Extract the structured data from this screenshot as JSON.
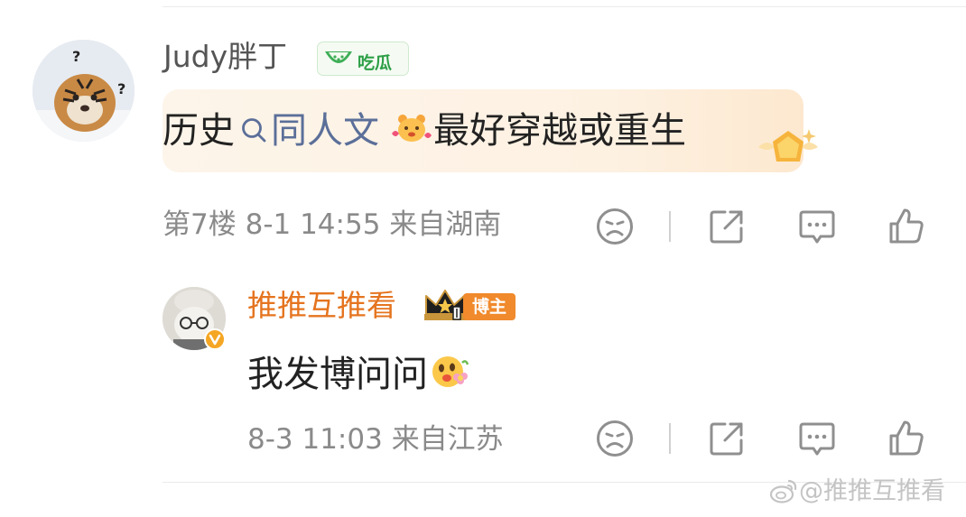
{
  "comments": [
    {
      "username": "Judy胖丁",
      "username_color": "#555555",
      "badge_label": "吃瓜",
      "content_prefix": "历史",
      "topic": "同人文",
      "content_suffix": "最好穿越或重生",
      "floor": "第7楼",
      "datetime": "8-1 14:55",
      "location": "来自湖南"
    },
    {
      "username": "推推互推看",
      "username_color": "#e5741f",
      "role_tag": "博主",
      "content": "我发博问问",
      "datetime": "8-3 11:03",
      "location": "来自江苏"
    }
  ],
  "actions": {
    "icons": [
      "dislike-icon",
      "share-icon",
      "comment-icon",
      "like-icon"
    ]
  },
  "watermark": "@推推互推看",
  "colors": {
    "topic": "#5b6f99",
    "meta_text": "#8a8a8a",
    "icon": "#8f8f8f",
    "blogger_tag": "#f08a2c",
    "melon_badge": "#2e9f47"
  }
}
